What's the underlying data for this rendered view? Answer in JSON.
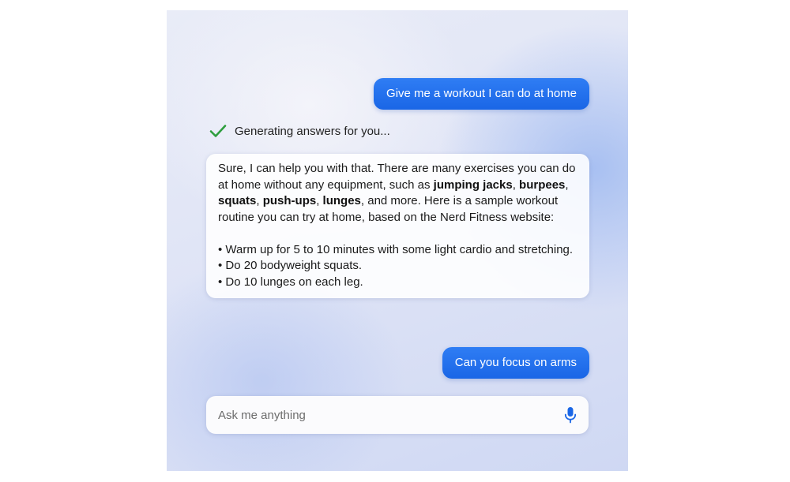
{
  "conversation": {
    "user_message_1": "Give me a workout I can do at home",
    "status_text": "Generating answers for you...",
    "answer": {
      "intro_1": "Sure, I can help you with that. There are many exercises you can do at home without any equipment, such as ",
      "bold_1": "jumping jacks",
      "sep_1": ", ",
      "bold_2": "burpees",
      "sep_2": ", ",
      "bold_3": "squats",
      "sep_3": ", ",
      "bold_4": "push-ups",
      "sep_4": ", ",
      "bold_5": "lunges",
      "intro_2": ", and more. Here is a sample workout routine you can try at home, based on the Nerd Fitness website:",
      "bullets": [
        "• Warm up for 5 to 10 minutes with some light cardio and stretching.",
        "• Do 20 bodyweight squats.",
        "• Do 10 lunges on each leg."
      ]
    },
    "user_message_2": "Can you focus on arms"
  },
  "input": {
    "placeholder": "Ask me anything"
  },
  "colors": {
    "user_bubble": "#1a66e6",
    "check": "#2e9e3e",
    "mic": "#1a66e6"
  },
  "icons": {
    "status": "checkmark-icon",
    "voice": "microphone-icon"
  }
}
